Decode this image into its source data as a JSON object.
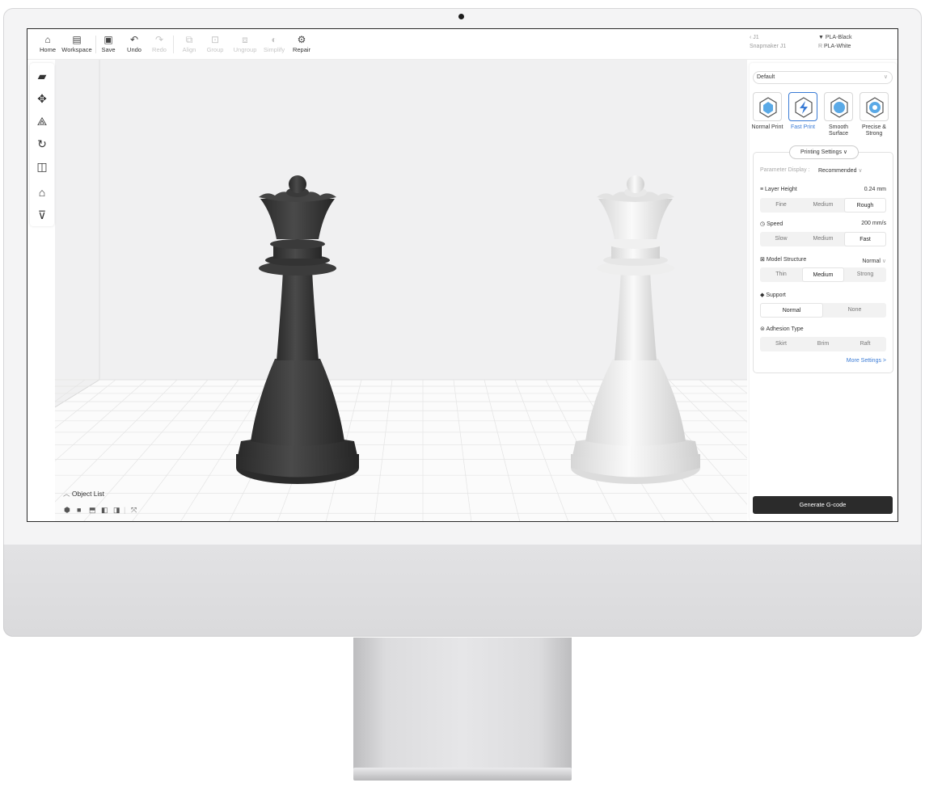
{
  "toolbar": {
    "items": [
      {
        "label": "Home",
        "icon": "home-icon",
        "enabled": true
      },
      {
        "label": "Workspace",
        "icon": "workspace-icon",
        "enabled": true
      },
      {
        "label": "Save",
        "icon": "save-icon",
        "enabled": true
      },
      {
        "label": "Undo",
        "icon": "undo-icon",
        "enabled": true
      },
      {
        "label": "Redo",
        "icon": "redo-icon",
        "enabled": false
      },
      {
        "label": "Align",
        "icon": "align-icon",
        "enabled": false
      },
      {
        "label": "Group",
        "icon": "group-icon",
        "enabled": false
      },
      {
        "label": "Ungroup",
        "icon": "ungroup-icon",
        "enabled": false
      },
      {
        "label": "Simplify",
        "icon": "simplify-icon",
        "enabled": false
      },
      {
        "label": "Repair",
        "icon": "repair-icon",
        "enabled": true
      }
    ],
    "machine": {
      "name": "J1",
      "model": "Snapmaker J1"
    },
    "materials": {
      "left": "PLA-Black",
      "right": "PLA-White"
    }
  },
  "left_tools": [
    "open-folder-icon",
    "move-icon",
    "scale-icon",
    "rotate-icon",
    "mirror-icon",
    "support-icon",
    "extruder-icon"
  ],
  "object_list": {
    "label": "Object List"
  },
  "panel": {
    "preset": "Default",
    "modes": [
      "Normal Print",
      "Fast Print",
      "Smooth Surface",
      "Precise & Strong"
    ],
    "selected_mode": "Fast Print",
    "printing_settings_label": "Printing Settings",
    "parameter_display_label": "Parameter Display :",
    "parameter_display_value": "Recommended",
    "layer_height": {
      "title": "Layer Height",
      "value": "0.24 mm",
      "options": [
        "Fine",
        "Medium",
        "Rough"
      ],
      "selected": "Rough"
    },
    "speed": {
      "title": "Speed",
      "value": "200 mm/s",
      "options": [
        "Slow",
        "Medium",
        "Fast"
      ],
      "selected": "Fast"
    },
    "model_structure": {
      "title": "Model Structure",
      "value": "Normal",
      "options": [
        "Thin",
        "Medium",
        "Strong"
      ],
      "selected": "Medium"
    },
    "support": {
      "title": "Support",
      "options": [
        "Normal",
        "None"
      ],
      "selected": "Normal"
    },
    "adhesion": {
      "title": "Adhesion Type",
      "options": [
        "Skirt",
        "Brim",
        "Raft"
      ],
      "selected": ""
    },
    "more_settings": "More Settings >",
    "generate_button": "Generate G-code"
  },
  "colors": {
    "accent": "#3a7bd5",
    "queen_left": "#3a3a3a",
    "queen_right": "#ececec",
    "generate_bg": "#2b2b2b"
  }
}
